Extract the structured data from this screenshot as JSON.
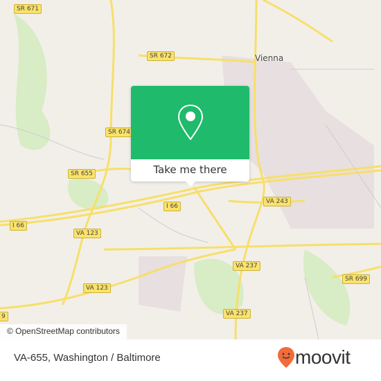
{
  "map": {
    "place_labels": [
      {
        "text": "Vienna"
      }
    ],
    "road_shields": [
      "SR 671",
      "SR 672",
      "SR 674",
      "SR 655",
      "I 66",
      "I 66",
      "VA 123",
      "VA 243",
      "VA 237",
      "VA 237",
      "VA 123",
      "SR 699",
      "9"
    ],
    "attribution": "© OpenStreetMap contributors"
  },
  "popup": {
    "icon": "location-pin-icon",
    "button_label": "Take me there",
    "color": "#1fba6b"
  },
  "footer": {
    "location": "VA-655, Washington / Baltimore",
    "brand": "moovit",
    "brand_color": "#f26b3a"
  }
}
